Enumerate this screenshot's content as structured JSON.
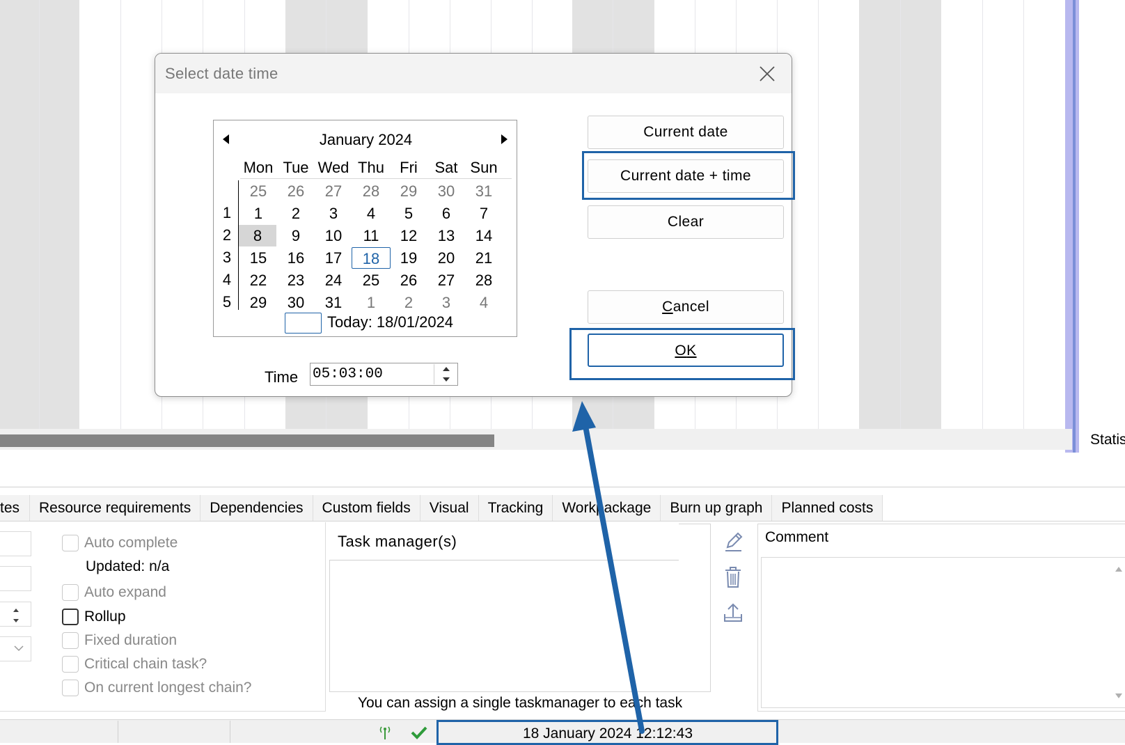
{
  "gantt": {
    "status_column_label": "Statis"
  },
  "dialog": {
    "title": "Select date time",
    "calendar": {
      "month_label": "January 2024",
      "day_names": [
        "Mon",
        "Tue",
        "Wed",
        "Thu",
        "Fri",
        "Sat",
        "Sun"
      ],
      "weeks": [
        {
          "week": "",
          "days": [
            "25",
            "26",
            "27",
            "28",
            "29",
            "30",
            "31"
          ]
        },
        {
          "week": "1",
          "days": [
            "1",
            "2",
            "3",
            "4",
            "5",
            "6",
            "7"
          ]
        },
        {
          "week": "2",
          "days": [
            "8",
            "9",
            "10",
            "11",
            "12",
            "13",
            "14"
          ]
        },
        {
          "week": "3",
          "days": [
            "15",
            "16",
            "17",
            "18",
            "19",
            "20",
            "21"
          ]
        },
        {
          "week": "4",
          "days": [
            "22",
            "23",
            "24",
            "25",
            "26",
            "27",
            "28"
          ]
        },
        {
          "week": "5",
          "days": [
            "29",
            "30",
            "31",
            "1",
            "2",
            "3",
            "4"
          ]
        }
      ],
      "selected_day": "8",
      "today_day": "18",
      "today_label": "Today: 18/01/2024"
    },
    "time_label": "Time",
    "time_value": "05:03:00",
    "buttons": {
      "current_date": "Current date",
      "current_date_time": "Current date + time",
      "clear": "Clear",
      "cancel_prefix": "",
      "cancel_mnemonic": "C",
      "cancel_rest": "ancel",
      "ok_mnemonic": "O",
      "ok_rest": "K"
    }
  },
  "tabs": [
    "tes",
    "Resource requirements",
    "Dependencies",
    "Custom fields",
    "Visual",
    "Tracking",
    "Workpackage",
    "Burn up graph",
    "Planned costs"
  ],
  "left_panel": {
    "updated_label": "Updated: n/a",
    "checkboxes": [
      {
        "label": "Auto complete",
        "enabled": false
      },
      {
        "label": "Auto expand",
        "enabled": false
      },
      {
        "label": "Rollup",
        "enabled": true
      },
      {
        "label": "Fixed duration",
        "enabled": false
      },
      {
        "label": "Critical chain task?",
        "enabled": false
      },
      {
        "label": "On current longest chain?",
        "enabled": false
      }
    ]
  },
  "task_manager": {
    "header": "Task manager(s)",
    "hint": "You can assign a single taskmanager to each task"
  },
  "comment": {
    "label": "Comment"
  },
  "statusbar": {
    "datetime": "18 January 2024 12:12:43"
  },
  "colors": {
    "highlight": "#1f63a8",
    "today_accent": "#1f63a8"
  }
}
